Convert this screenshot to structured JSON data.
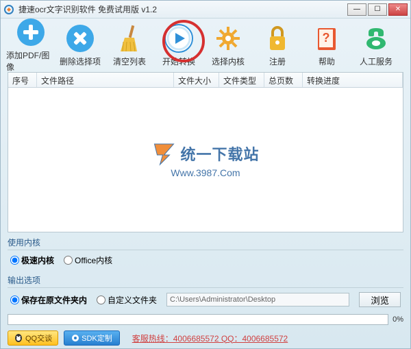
{
  "window": {
    "title": "捷速ocr文字识别软件 免费试用版 v1.2"
  },
  "toolbar": {
    "items": [
      {
        "label": "添加PDF/图像",
        "icon": "add-icon"
      },
      {
        "label": "删除选择项",
        "icon": "delete-icon"
      },
      {
        "label": "清空列表",
        "icon": "clear-icon"
      },
      {
        "label": "开始转换",
        "icon": "start-icon"
      },
      {
        "label": "选择内核",
        "icon": "engine-icon"
      },
      {
        "label": "注册",
        "icon": "register-icon"
      },
      {
        "label": "帮助",
        "icon": "help-icon"
      },
      {
        "label": "人工服务",
        "icon": "support-icon"
      }
    ]
  },
  "table": {
    "headers": [
      "序号",
      "文件路径",
      "文件大小",
      "文件类型",
      "总页数",
      "转换进度"
    ]
  },
  "watermark": {
    "main": "统一下载站",
    "sub": "Www.3987.Com"
  },
  "engine_section": {
    "title": "使用内核",
    "opt1": "极速内核",
    "opt2": "Office内核"
  },
  "output_section": {
    "title": "输出选项",
    "opt1": "保存在原文件夹内",
    "opt2": "自定义文件夹",
    "path": "C:\\Users\\Administrator\\Desktop",
    "browse": "浏览"
  },
  "progress": {
    "pct": "0%"
  },
  "footer": {
    "qq": "QQ交谈",
    "sdk": "SDK定制",
    "hotline": "客服热线：4006685572 QQ：4006685572"
  }
}
